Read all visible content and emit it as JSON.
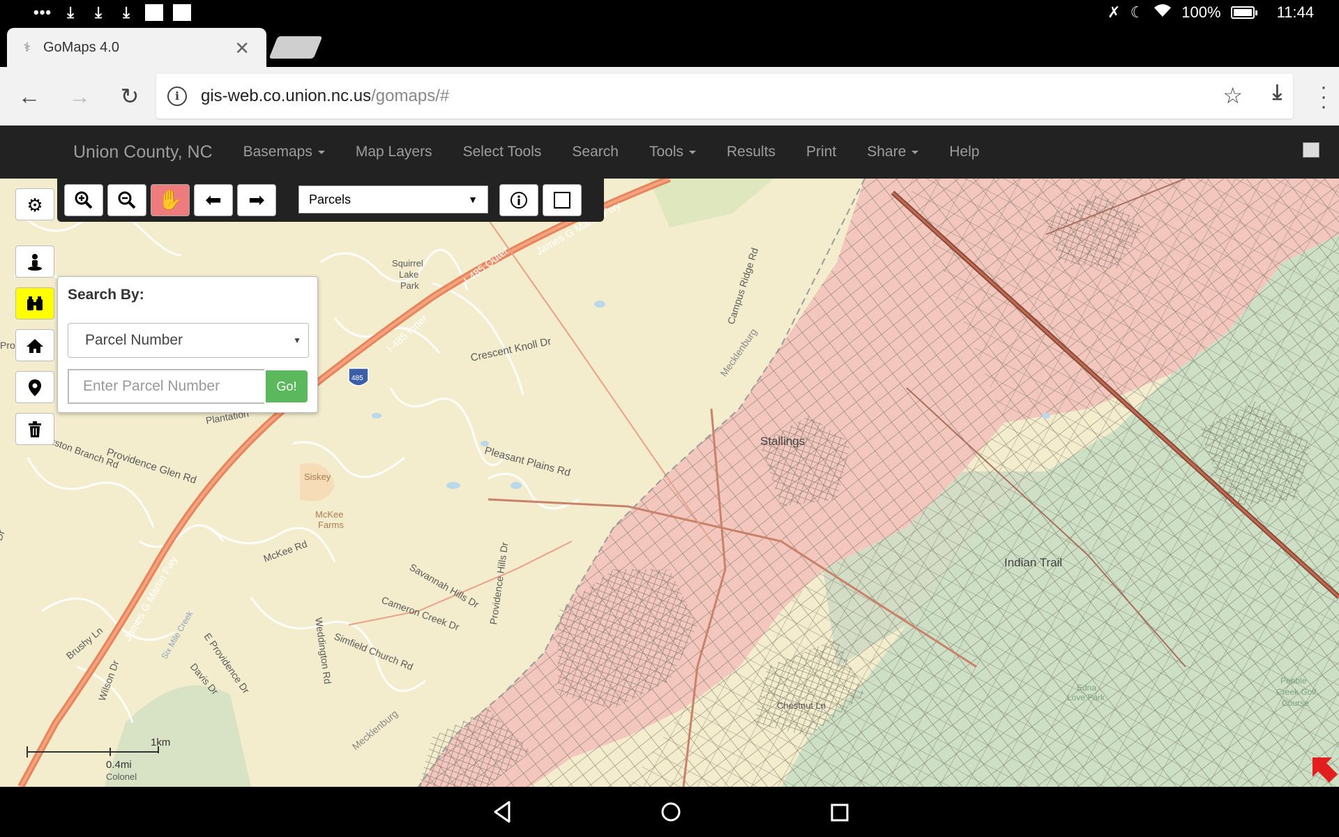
{
  "status_bar": {
    "battery": "100%",
    "time": "11:44",
    "notification_dots": "•••"
  },
  "tab": {
    "title": "GoMaps 4.0",
    "close": "✕"
  },
  "address_bar": {
    "url_host": "gis-web.co.union.nc.us",
    "url_path": "/gomaps/#"
  },
  "navbar": {
    "brand": "Union County, NC",
    "items": [
      {
        "label": "Basemaps",
        "dropdown": true
      },
      {
        "label": "Map Layers",
        "dropdown": false
      },
      {
        "label": "Select Tools",
        "dropdown": false
      },
      {
        "label": "Search",
        "dropdown": false
      },
      {
        "label": "Tools",
        "dropdown": true
      },
      {
        "label": "Results",
        "dropdown": false
      },
      {
        "label": "Print",
        "dropdown": false
      },
      {
        "label": "Share",
        "dropdown": true
      },
      {
        "label": "Help",
        "dropdown": false
      }
    ]
  },
  "map_toolbar": {
    "layer_select": "Parcels",
    "active_tool": "pan-hand"
  },
  "search_panel": {
    "title": "Search By:",
    "search_type": "Parcel Number",
    "input_placeholder": "Enter Parcel Number",
    "go_label": "Go!"
  },
  "scale_bar": {
    "km_label": "1km",
    "mi_label": "0.4mi"
  },
  "map_labels": {
    "i485_outer": "I-485 Outer",
    "i485_inner": "I-485 Inner",
    "jgm_fwy_top": "James G Martin Fwy",
    "jgm_fwy_bottom": "James G Martin Fwy",
    "shield": "485",
    "squirrel": "Squirrel",
    "lake": "Lake",
    "park": "Park",
    "crescent": "Crescent Knoll Dr",
    "campus": "Campus Ridge Rd",
    "mecklenburg1": "Mecklenburg",
    "mecklenburg2": "Mecklenburg",
    "plantation": "Plantation",
    "houston": "uston Branch Rd",
    "providence_glen": "Providence Glen Rd",
    "pleasant": "Pleasant Plains Rd",
    "stallings": "Stallings",
    "siskey": "Siskey",
    "mckee_farms1": "McKee",
    "mckee_farms2": "Farms",
    "mckee_rd": "McKee Rd",
    "savannah": "Savannah Hills Dr",
    "providence_hills": "Providence Hills Dr",
    "cameron": "Cameron Creek Dr",
    "simfield": "Simfield Church Rd",
    "weddington": "Weddington Rd",
    "brushy": "Brushy Ln",
    "wilson": "Wilson Dr",
    "davis": "Davis Dr",
    "e_providence": "E Providence Dr",
    "six_mile": "Six Mile Creek",
    "colonel": "Colonel",
    "indian_trail": "Indian Trail",
    "edna1": "Edna",
    "edna2": "Love Park",
    "pebble1": "Pebble",
    "pebble2": "Creek Golf",
    "pebble3": "Course",
    "chestnut": "Chestnut Ln",
    "pro": "Pro",
    "dr": "Dr"
  },
  "colors": {
    "navbar_bg": "#222222",
    "map_base": "#f3eccd",
    "parcel_pink": "#f3c7bd",
    "parcel_green": "#cddfc4",
    "parcel_line": "#6e6a5c",
    "highway": "#e8845c",
    "go_button": "#5cb85c",
    "pan_active": "#ef7c7c",
    "binoculars_bg": "#ffff00"
  }
}
